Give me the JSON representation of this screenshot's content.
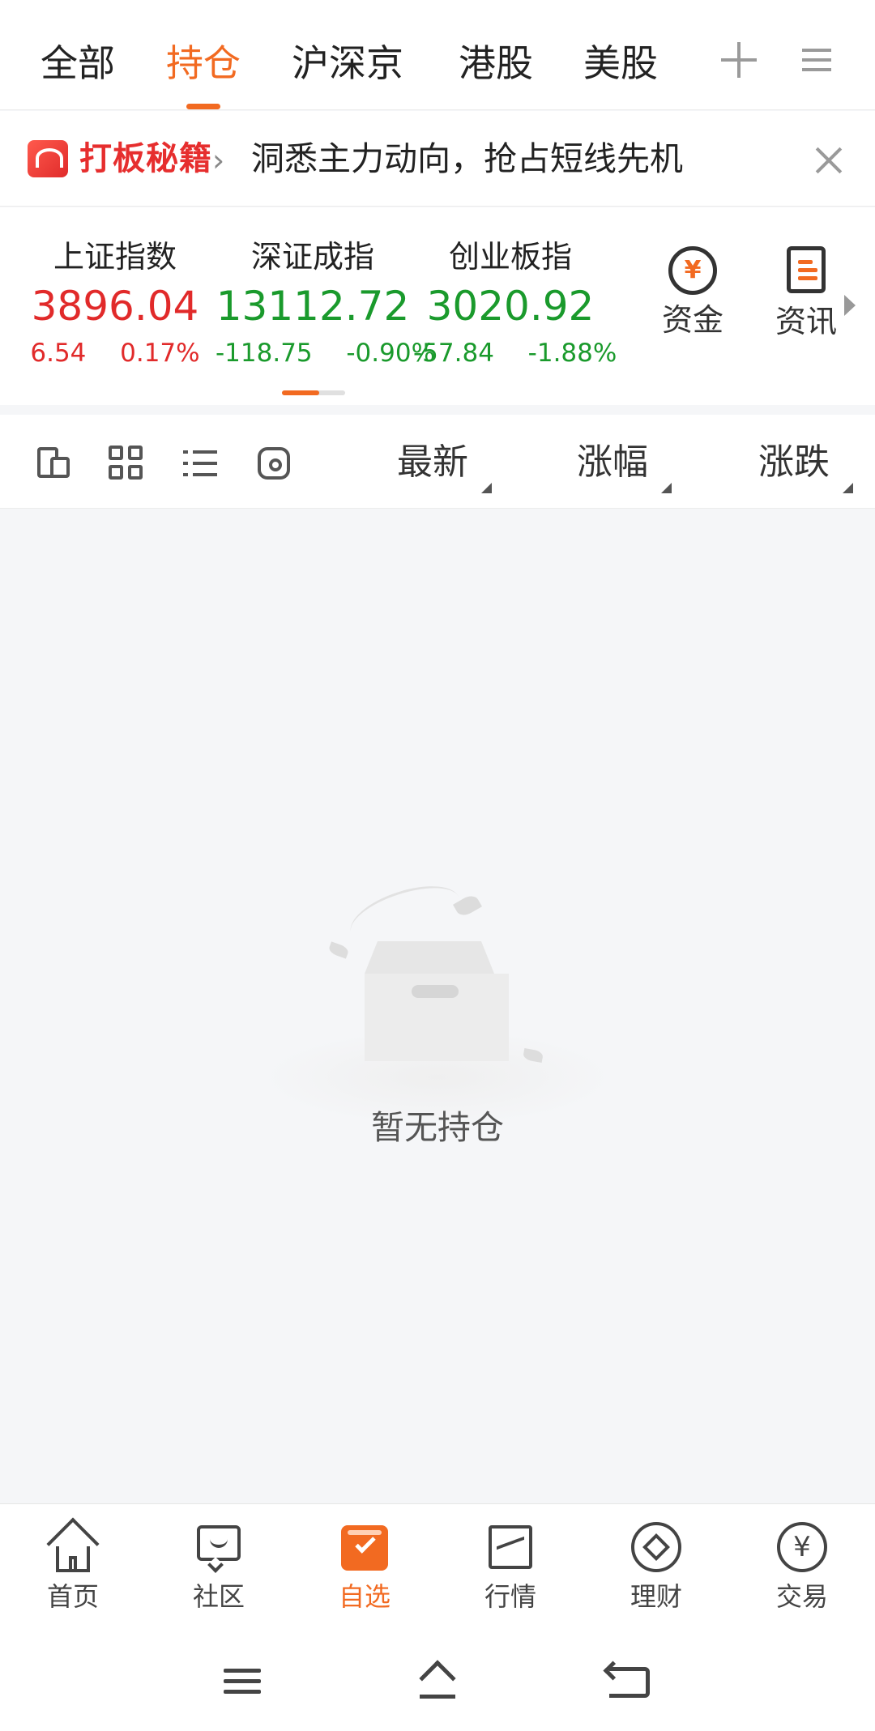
{
  "tabs": [
    {
      "label": "全部",
      "active": false
    },
    {
      "label": "持仓",
      "active": true
    },
    {
      "label": "沪深京",
      "active": false
    },
    {
      "label": "港股",
      "active": false
    },
    {
      "label": "美股",
      "active": false
    }
  ],
  "banner": {
    "brand": "打板秘籍",
    "chevron": "›",
    "text": "洞悉主力动向，抢占短线先机"
  },
  "indices": [
    {
      "name": "上证指数",
      "value": "3896.04",
      "change": "6.54",
      "percent": "0.17%",
      "trend": "up"
    },
    {
      "name": "深证成指",
      "value": "13112.72",
      "change": "-118.75",
      "percent": "-0.90%",
      "trend": "down"
    },
    {
      "name": "创业板指",
      "value": "3020.92",
      "change": "-57.84",
      "percent": "-1.88%",
      "trend": "down"
    }
  ],
  "quick_links": [
    {
      "label": "资金",
      "icon": "fund-icon",
      "symbol": "¥"
    },
    {
      "label": "资讯",
      "icon": "news-icon"
    }
  ],
  "list_header": {
    "tools": [
      "switch-view-icon",
      "grid-view-icon",
      "list-view-icon",
      "settings-icon"
    ],
    "columns": [
      "最新",
      "涨幅",
      "涨跌"
    ]
  },
  "empty_state": {
    "text": "暂无持仓"
  },
  "bottom_nav": [
    {
      "label": "首页",
      "icon": "home-icon",
      "active": false
    },
    {
      "label": "社区",
      "icon": "community-icon",
      "active": false
    },
    {
      "label": "自选",
      "icon": "watchlist-icon",
      "active": true
    },
    {
      "label": "行情",
      "icon": "market-icon",
      "active": false
    },
    {
      "label": "理财",
      "icon": "wealth-icon",
      "active": false
    },
    {
      "label": "交易",
      "icon": "trade-icon",
      "symbol": "¥",
      "active": false
    }
  ],
  "colors": {
    "accent": "#f26a21",
    "up": "#e12a2a",
    "down": "#1a9a2c",
    "brand_red": "#e62e2e",
    "background": "#f5f6f8"
  }
}
